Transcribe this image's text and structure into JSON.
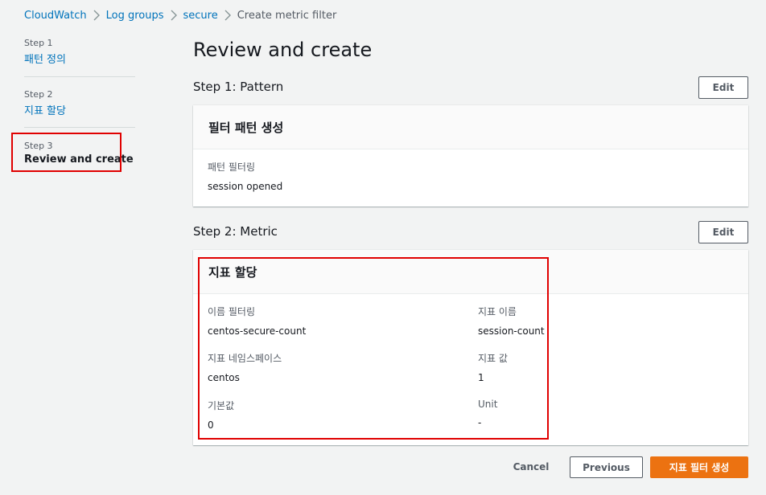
{
  "breadcrumb": {
    "items": [
      "CloudWatch",
      "Log groups",
      "secure"
    ],
    "current": "Create metric filter"
  },
  "sidebar": {
    "steps": [
      {
        "num": "Step 1",
        "label": "패턴 정의"
      },
      {
        "num": "Step 2",
        "label": "지표 할당"
      },
      {
        "num": "Step 3",
        "label": "Review and create"
      }
    ]
  },
  "page": {
    "title": "Review and create"
  },
  "step1": {
    "title": "Step 1: Pattern",
    "edit": "Edit",
    "card_title": "필터 패턴 생성",
    "field_label": "패턴 필터링",
    "field_value": "session opened"
  },
  "step2": {
    "title": "Step 2: Metric",
    "edit": "Edit",
    "card_title": "지표 할당",
    "fields": [
      {
        "label": "이름 필터링",
        "value": "centos-secure-count"
      },
      {
        "label": "지표 이름",
        "value": "session-count"
      },
      {
        "label": "지표 네임스페이스",
        "value": "centos"
      },
      {
        "label": "지표 값",
        "value": "1"
      },
      {
        "label": "기본값",
        "value": "0"
      },
      {
        "label": "Unit",
        "value": "-"
      }
    ]
  },
  "actions": {
    "cancel": "Cancel",
    "previous": "Previous",
    "create": "지표 필터 생성"
  },
  "colors": {
    "link": "#0073bb",
    "primary": "#ec7211",
    "highlight": "#e00000",
    "background": "#f2f3f3"
  }
}
